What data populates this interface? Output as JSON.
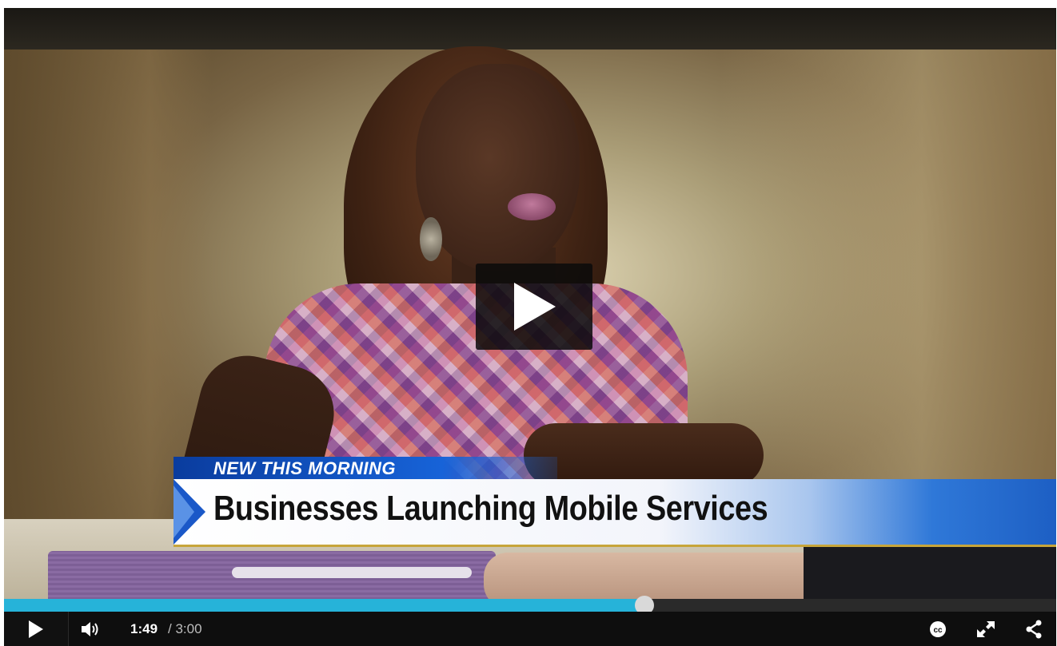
{
  "video": {
    "lower_third": {
      "kicker": "NEW THIS MORNING",
      "headline": "Businesses Launching Mobile Services"
    },
    "big_play_icon": "play-icon"
  },
  "controls": {
    "play_icon": "play-icon",
    "volume_icon": "volume-icon",
    "time_current": "1:49",
    "time_total": "/ 3:00",
    "cc_icon": "closed-captions-icon",
    "fullscreen_icon": "fullscreen-icon",
    "share_icon": "share-icon",
    "progress_fraction": 0.6083
  },
  "colors": {
    "progress_fill": "#26b3d9",
    "lower_third_blue": "#1763d8",
    "control_bar": "#0e0e0e"
  }
}
